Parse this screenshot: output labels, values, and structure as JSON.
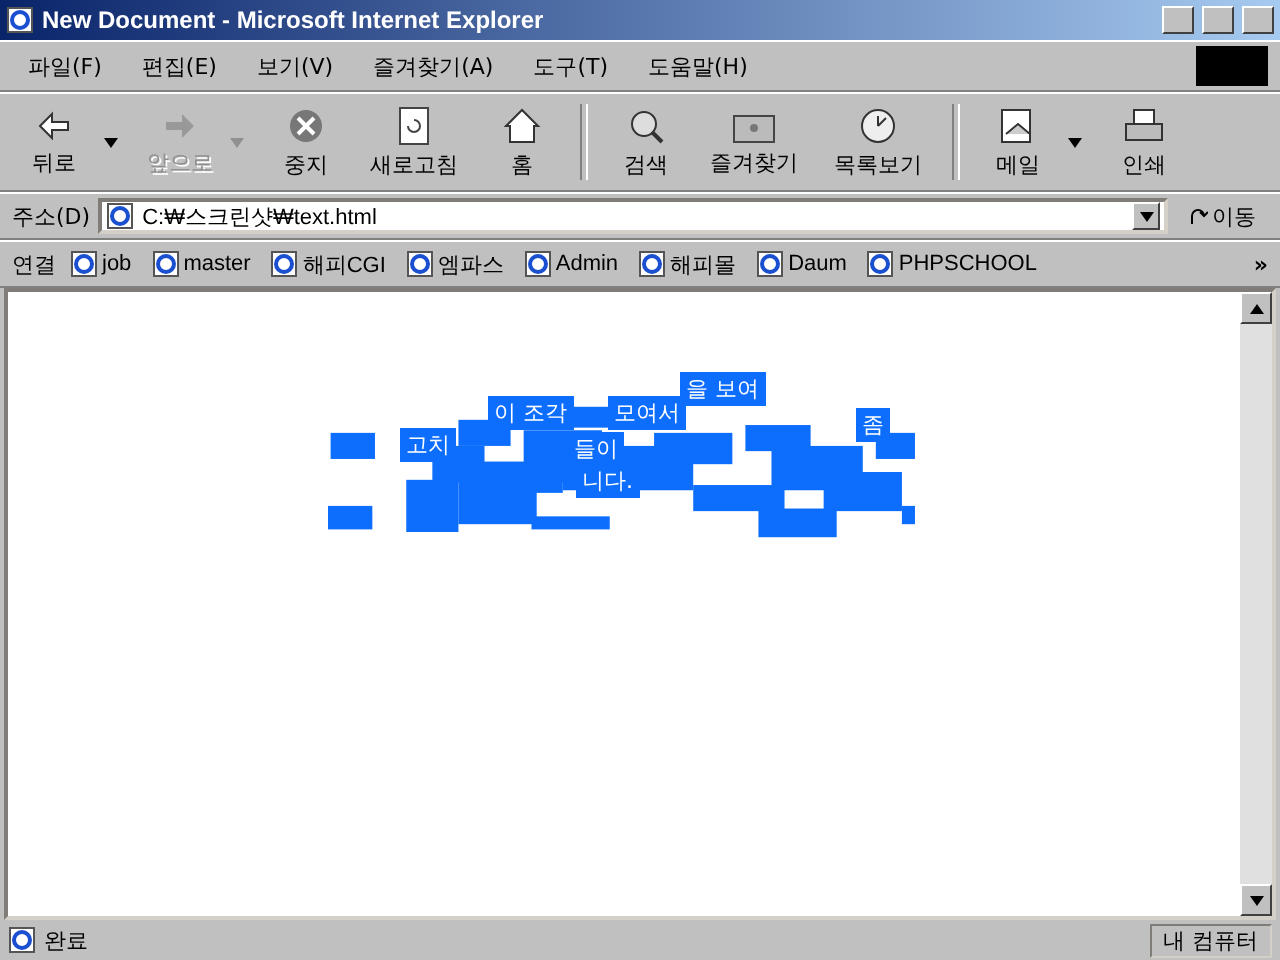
{
  "window": {
    "title": "New Document - Microsoft Internet Explorer"
  },
  "menu": [
    "파일(F)",
    "편집(E)",
    "보기(V)",
    "즐겨찾기(A)",
    "도구(T)",
    "도움말(H)"
  ],
  "toolbar": [
    {
      "label": "뒤로",
      "kind": "back",
      "disabled": false,
      "dropdown": true
    },
    {
      "label": "앞으로",
      "kind": "forward",
      "disabled": true,
      "dropdown": true
    },
    {
      "label": "중지",
      "kind": "stop",
      "disabled": false,
      "dropdown": false
    },
    {
      "label": "새로고침",
      "kind": "refresh",
      "disabled": false,
      "dropdown": false
    },
    {
      "label": "홈",
      "kind": "home",
      "disabled": false,
      "dropdown": false
    },
    {
      "kind": "separator"
    },
    {
      "label": "검색",
      "kind": "search",
      "disabled": false,
      "dropdown": false
    },
    {
      "label": "즐겨찾기",
      "kind": "favorites",
      "disabled": false,
      "dropdown": false
    },
    {
      "label": "목록보기",
      "kind": "history",
      "disabled": false,
      "dropdown": false
    },
    {
      "kind": "separator"
    },
    {
      "label": "메일",
      "kind": "mail",
      "disabled": false,
      "dropdown": true
    },
    {
      "label": "인쇄",
      "kind": "print",
      "disabled": false,
      "dropdown": false
    }
  ],
  "address": {
    "label": "주소(D)",
    "value": "C:₩스크린샷₩text.html",
    "go": "이동"
  },
  "links": {
    "label": "연결",
    "items": [
      "job",
      "master",
      "해피CGI",
      "엠파스",
      "Admin",
      "해피몰",
      "Daum",
      "PHPSCHOOL"
    ],
    "more": "»"
  },
  "page": {
    "fragments": [
      "을 보여",
      "이 조각",
      "모여서",
      "들이",
      "니다.",
      "고치",
      "좀"
    ]
  },
  "status": {
    "text": "완료",
    "zone": "내 컴퓨터"
  }
}
